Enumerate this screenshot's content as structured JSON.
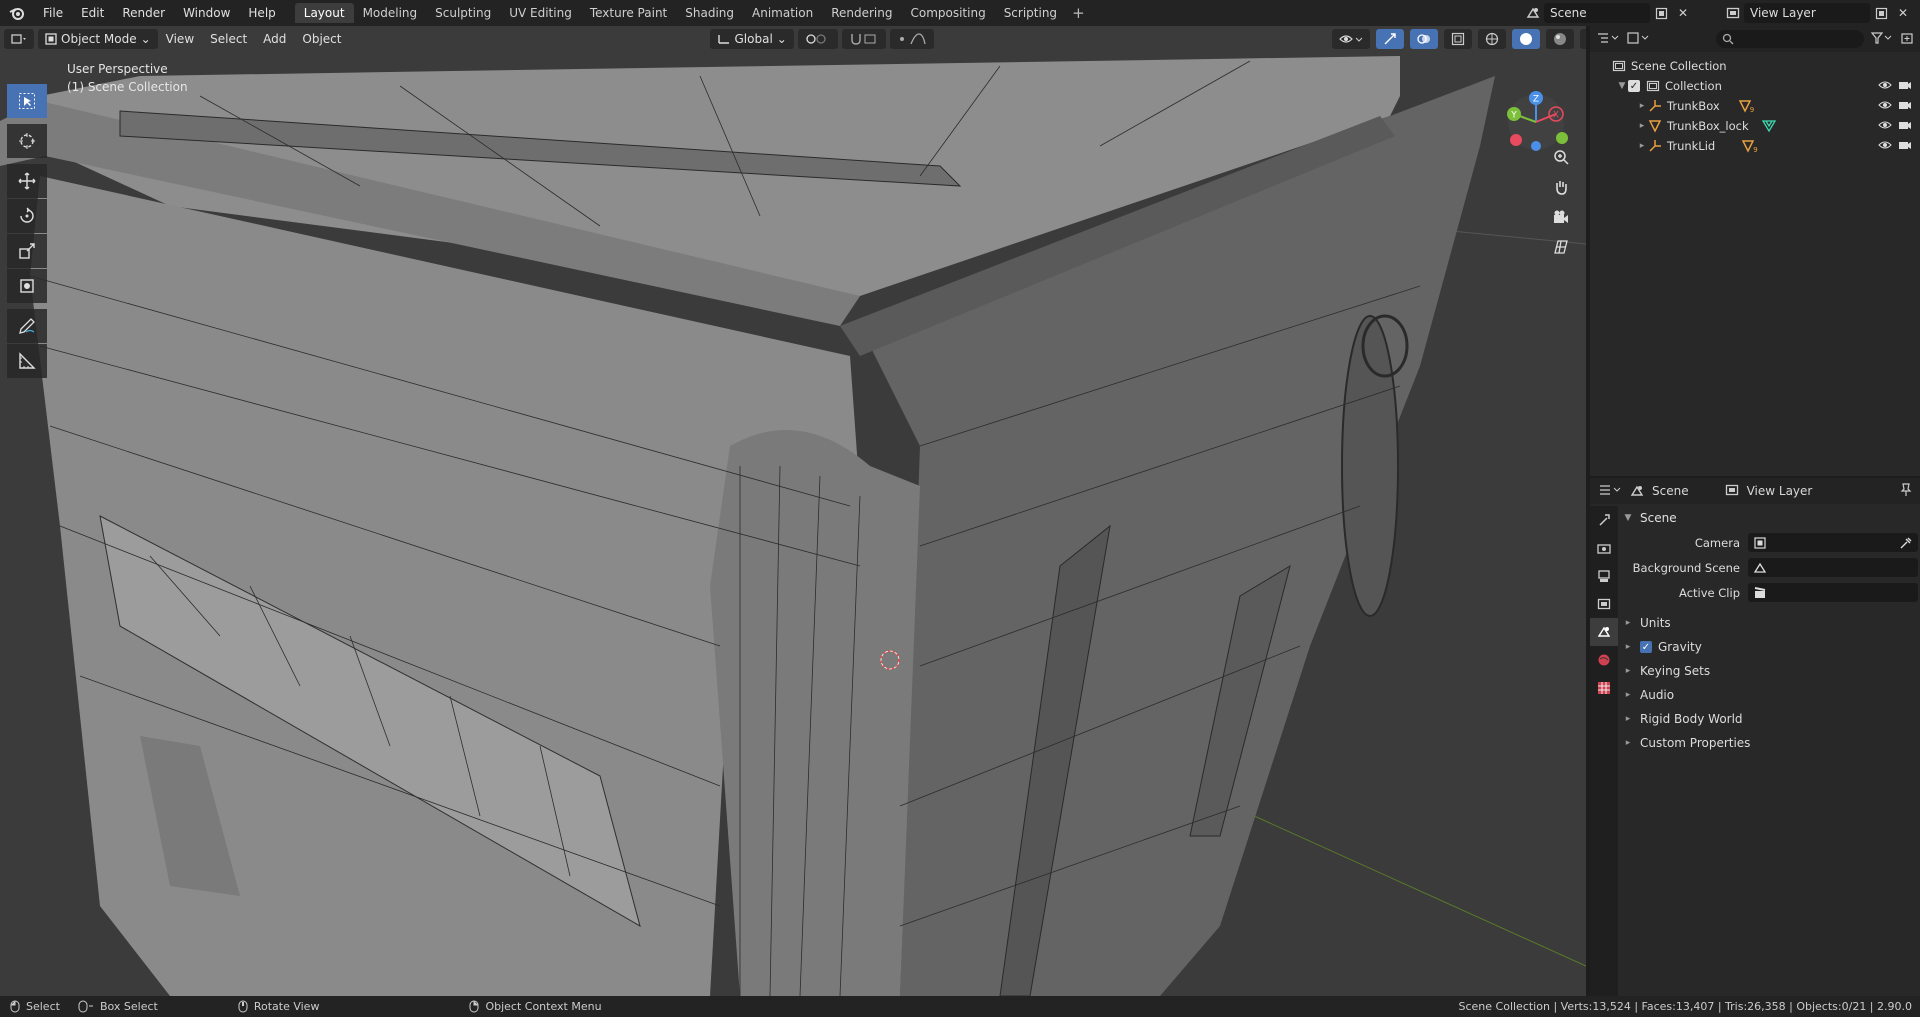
{
  "topbar": {
    "menus": [
      "File",
      "Edit",
      "Render",
      "Window",
      "Help"
    ],
    "workspaces": [
      "Layout",
      "Modeling",
      "Sculpting",
      "UV Editing",
      "Texture Paint",
      "Shading",
      "Animation",
      "Rendering",
      "Compositing",
      "Scripting"
    ],
    "active_workspace": "Layout",
    "scene": "Scene",
    "view_layer": "View Layer"
  },
  "viewport": {
    "mode": "Object Mode",
    "menus": [
      "View",
      "Select",
      "Add",
      "Object"
    ],
    "orientation": "Global",
    "view_name": "User Perspective",
    "collection_name": "(1) Scene Collection",
    "gizmo": {
      "x": "X",
      "y": "Y",
      "z": "Z"
    }
  },
  "outliner": {
    "root": "Scene Collection",
    "collection": "Collection",
    "objects": [
      {
        "name": "TrunkBox",
        "badge": "9"
      },
      {
        "name": "TrunkBox_lock",
        "badge": ""
      },
      {
        "name": "TrunkLid",
        "badge": "9"
      }
    ]
  },
  "properties": {
    "header_scene": "Scene",
    "header_view_layer": "View Layer",
    "panel_title": "Scene",
    "rows": [
      {
        "label": "Camera"
      },
      {
        "label": "Background Scene"
      },
      {
        "label": "Active Clip"
      }
    ],
    "subpanels": [
      {
        "label": "Units",
        "checkbox": false
      },
      {
        "label": "Gravity",
        "checkbox": true
      },
      {
        "label": "Keying Sets",
        "checkbox": false
      },
      {
        "label": "Audio",
        "checkbox": false
      },
      {
        "label": "Rigid Body World",
        "checkbox": false
      },
      {
        "label": "Custom Properties",
        "checkbox": false
      }
    ]
  },
  "statusbar": {
    "select": "Select",
    "box_select": "Box Select",
    "rotate_view": "Rotate View",
    "context_menu": "Object Context Menu",
    "stats": "Scene Collection | Verts:13,524 | Faces:13,407 | Tris:26,358 | Objects:0/21 | 2.90.0"
  },
  "colors": {
    "accent": "#4772b3",
    "active_tab": "#3d3d3d",
    "x_axis": "#e84a5f",
    "y_axis": "#7cbf3a",
    "z_axis": "#4a8fe8"
  }
}
